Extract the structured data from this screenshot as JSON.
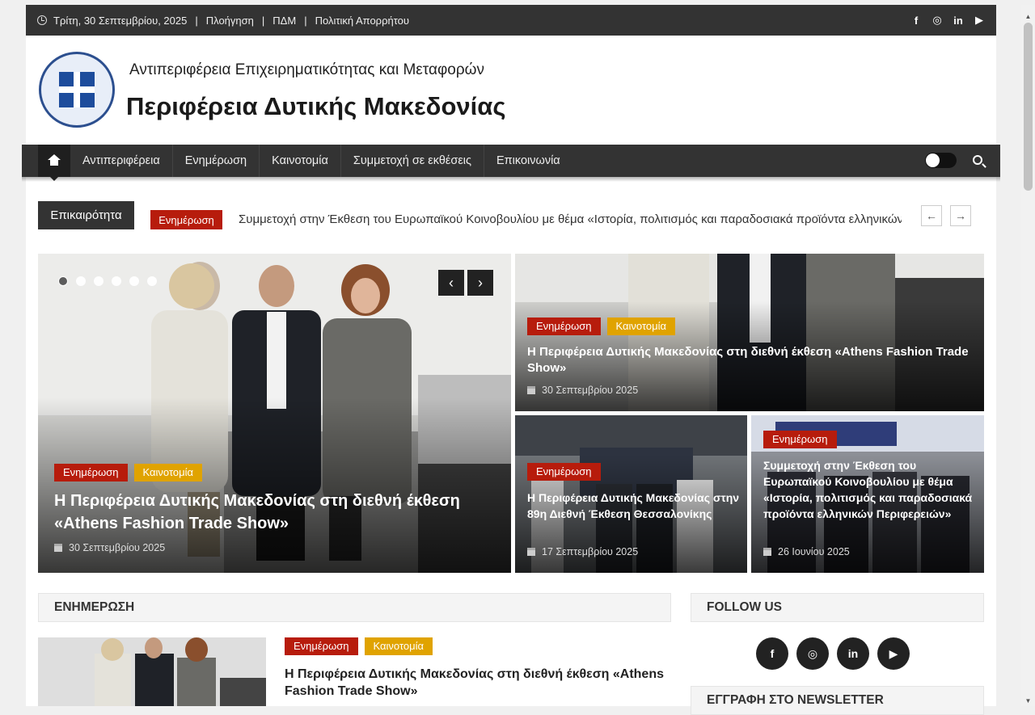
{
  "topbar": {
    "date": "Τρίτη, 30 Σεπτεμβρίου, 2025",
    "links": [
      "Πλοήγηση",
      "ΠΔΜ",
      "Πολιτική Απορρήτου"
    ],
    "social": [
      "f",
      "◎",
      "in",
      "▶"
    ]
  },
  "header": {
    "subtitle": "Αντιπεριφέρεια Επιχειρηματικότητας και Μεταφορών",
    "title": "Περιφέρεια Δυτικής Μακεδονίας"
  },
  "nav": {
    "items": [
      "Αντιπεριφέρεια",
      "Ενημέρωση",
      "Καινοτομία",
      "Συμμετοχή σε εκθέσεις",
      "Επικοινωνία"
    ]
  },
  "ticker": {
    "label": "Επικαιρότητα",
    "tag": "Ενημέρωση",
    "text": "Συμμετοχή στην Έκθεση του Ευρωπαϊκού Κοινοβουλίου με θέμα «Ιστορία, πολιτισμός και παραδοσιακά προϊόντα ελληνικών Περιφερειών»",
    "prev": "←",
    "next": "→"
  },
  "slider": {
    "prev": "‹",
    "next": "›",
    "cat1": "Ενημέρωση",
    "cat2": "Καινοτομία",
    "title": "Η Περιφέρεια Δυτικής Μακεδονίας στη διεθνή έκθεση «Athens Fashion Trade Show»",
    "date": "30 Σεπτεμβρίου 2025"
  },
  "cards": [
    {
      "cat1": "Ενημέρωση",
      "cat2": "Καινοτομία",
      "title": "Η Περιφέρεια Δυτικής Μακεδονίας στη διεθνή έκθεση «Athens Fashion Trade Show»",
      "date": "30 Σεπτεμβρίου 2025"
    },
    {
      "cat1": "Ενημέρωση",
      "title": "Η Περιφέρεια Δυτικής Μακεδονίας στην 89η Διεθνή Έκθεση Θεσσαλονίκης",
      "date": "17 Σεπτεμβρίου 2025"
    },
    {
      "cat1": "Ενημέρωση",
      "title": "Συμμετοχή στην Έκθεση του Ευρωπαϊκού Κοινοβουλίου με θέμα «Ιστορία, πολιτισμός και παραδοσιακά προϊόντα ελληνικών Περιφερειών»",
      "date": "26 Ιουνίου 2025"
    }
  ],
  "sections": {
    "news_heading": "ΕΝΗΜΕΡΩΣΗ",
    "follow_heading": "FOLLOW US",
    "newsletter_heading": "ΕΓΓΡΑΦΗ ΣΤΟ NEWSLETTER"
  },
  "news": {
    "cat1": "Ενημέρωση",
    "cat2": "Καινοτομία",
    "title": "Η Περιφέρεια Δυτικής Μακεδονίας στη διεθνή έκθεση «Athens Fashion Trade Show»"
  },
  "follow": [
    "f",
    "◎",
    "in",
    "▶"
  ],
  "colors": {
    "accent_red": "#b71c0c",
    "accent_gold": "#e0a300",
    "dark": "#333333"
  }
}
